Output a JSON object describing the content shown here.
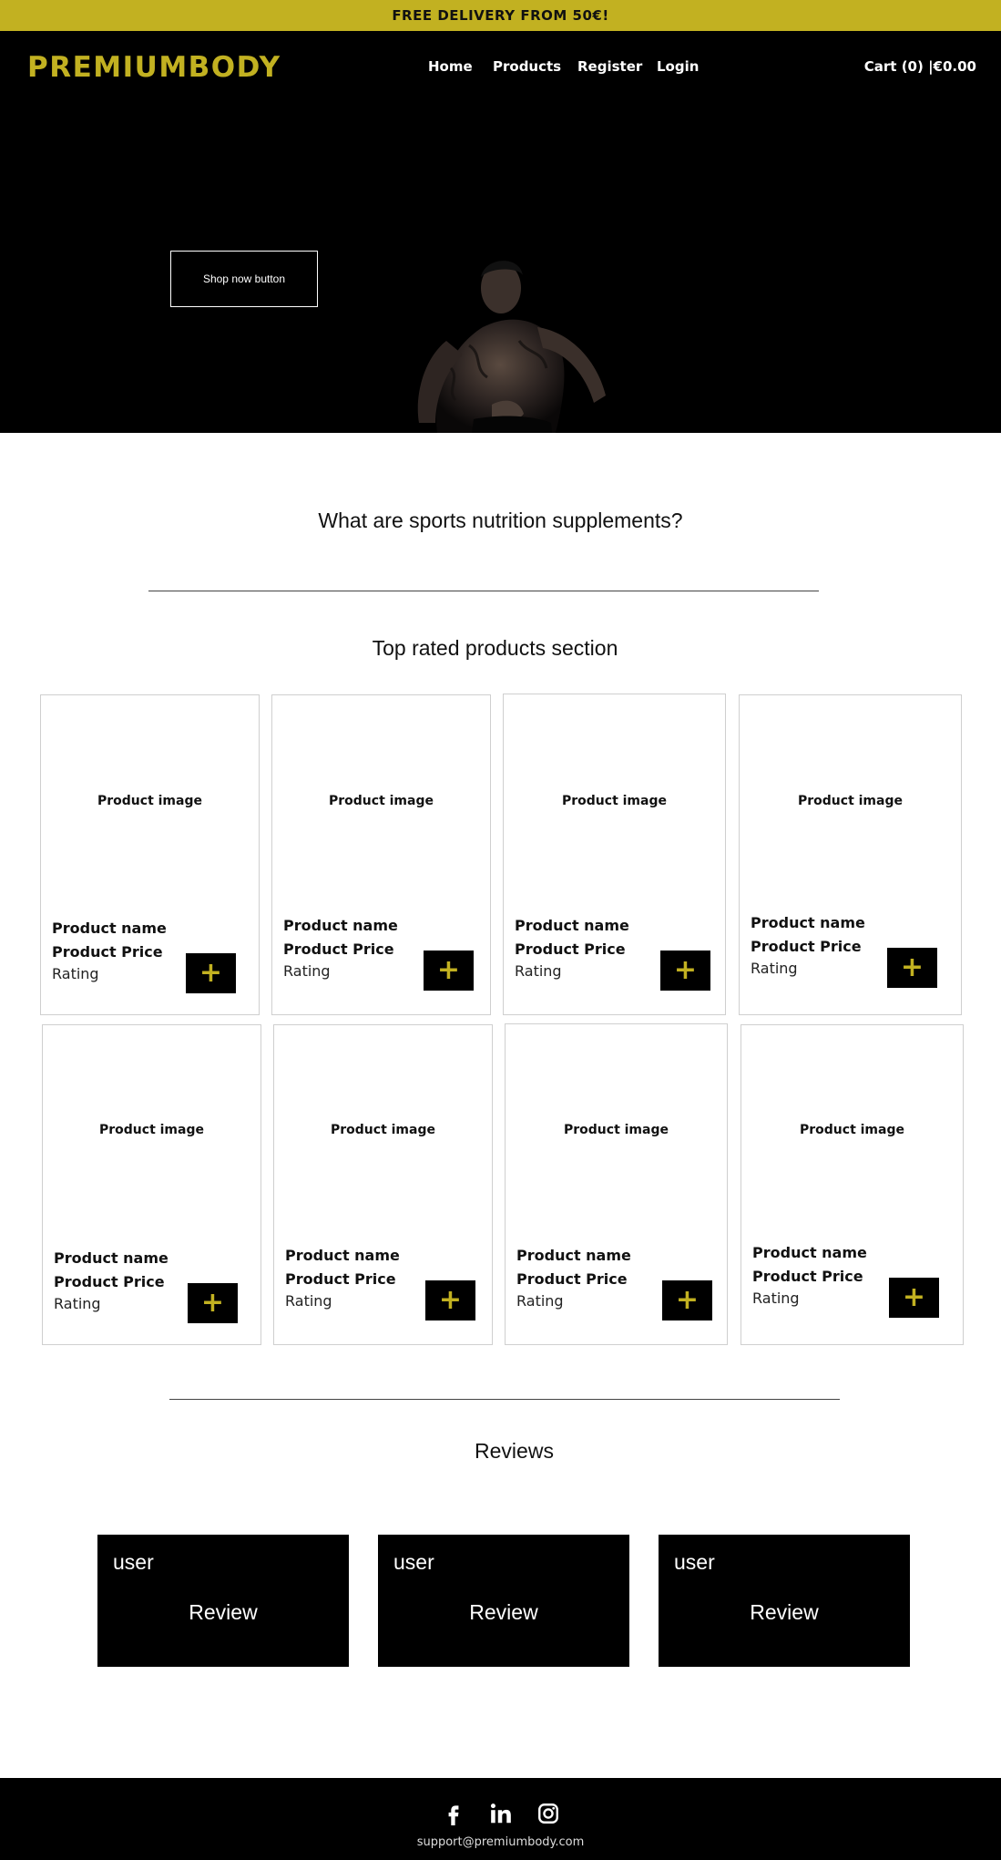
{
  "announcement": "FREE DELIVERY FROM 50€!",
  "brand": {
    "name": "PREMIUMBODY",
    "accent_color": "#c2b121"
  },
  "nav": {
    "home": "Home",
    "products": "Products",
    "register": "Register",
    "login": "Login"
  },
  "cart": {
    "label": "Cart (0) |€0.00"
  },
  "hero": {
    "button_label": "Shop now button"
  },
  "sections": {
    "info_heading": "What are  sports nutrition supplements?",
    "top_rated_heading": "Top rated products section",
    "reviews_heading": "Reviews"
  },
  "products": [
    {
      "image": "Product image",
      "name": "Product name",
      "price": "Product Price",
      "rating": "Rating",
      "add": "+"
    },
    {
      "image": "Product image",
      "name": "Product name",
      "price": "Product Price",
      "rating": "Rating",
      "add": "+"
    },
    {
      "image": "Product image",
      "name": "Product name",
      "price": "Product Price",
      "rating": "Rating",
      "add": "+"
    },
    {
      "image": "Product image",
      "name": "Product name",
      "price": "Product Price",
      "rating": "Rating",
      "add": "+"
    },
    {
      "image": "Product image",
      "name": "Product name",
      "price": "Product Price",
      "rating": "Rating",
      "add": "+"
    },
    {
      "image": "Product image",
      "name": "Product name",
      "price": "Product Price",
      "rating": "Rating",
      "add": "+"
    },
    {
      "image": "Product image",
      "name": "Product name",
      "price": "Product Price",
      "rating": "Rating",
      "add": "+"
    },
    {
      "image": "Product image",
      "name": "Product name",
      "price": "Product Price",
      "rating": "Rating",
      "add": "+"
    }
  ],
  "reviews": [
    {
      "user": "user",
      "text": "Review"
    },
    {
      "user": "user",
      "text": "Review"
    },
    {
      "user": "user",
      "text": "Review"
    }
  ],
  "footer": {
    "social_icons": [
      "facebook-icon",
      "linkedin-icon",
      "instagram-icon"
    ],
    "email": "support@premiumbody.com"
  }
}
